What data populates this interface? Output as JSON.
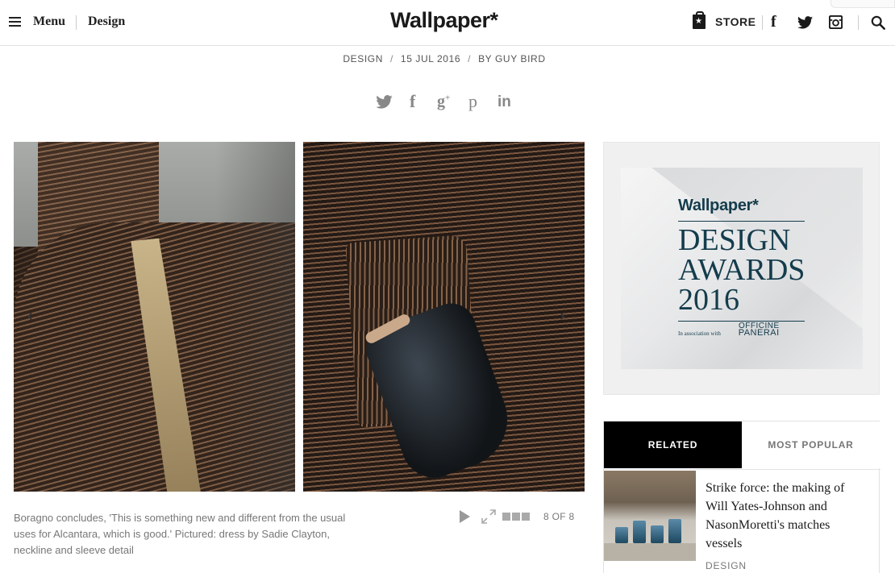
{
  "header": {
    "menu_label": "Menu",
    "section_label": "Design",
    "logo": "Wallpaper*",
    "store_label": "STORE",
    "icons": [
      "facebook-icon",
      "twitter-icon",
      "instagram-icon",
      "search-icon"
    ]
  },
  "meta": {
    "category": "DESIGN",
    "date": "15 JUL 2016",
    "byline": "BY GUY BIRD"
  },
  "share_icons": [
    "twitter-icon",
    "facebook-icon",
    "google-plus-icon",
    "pinterest-icon",
    "linkedin-icon"
  ],
  "gallery": {
    "caption": "Boragno concludes, 'This is something new and different from the usual uses for Alcantara, which is good.' Pictured: dress by Sadie Clayton, neckline and sleeve detail",
    "counter": "8 OF 8",
    "prev_arrow": "‹",
    "next_arrow": "›"
  },
  "ad": {
    "brand": "Wallpaper*",
    "title_line1": "DESIGN",
    "title_line2": "AWARDS",
    "title_line3": "2016",
    "association": "In association with",
    "partner_line1": "OFFICINE",
    "partner_line2": "PANERAI",
    "accent_color": "#143c4c"
  },
  "tabs": {
    "related": "RELATED",
    "popular": "MOST POPULAR"
  },
  "related_article": {
    "title": "Strike force: the making of Will Yates-Johnson and NasonMoretti's matches vessels",
    "category": "DESIGN"
  }
}
